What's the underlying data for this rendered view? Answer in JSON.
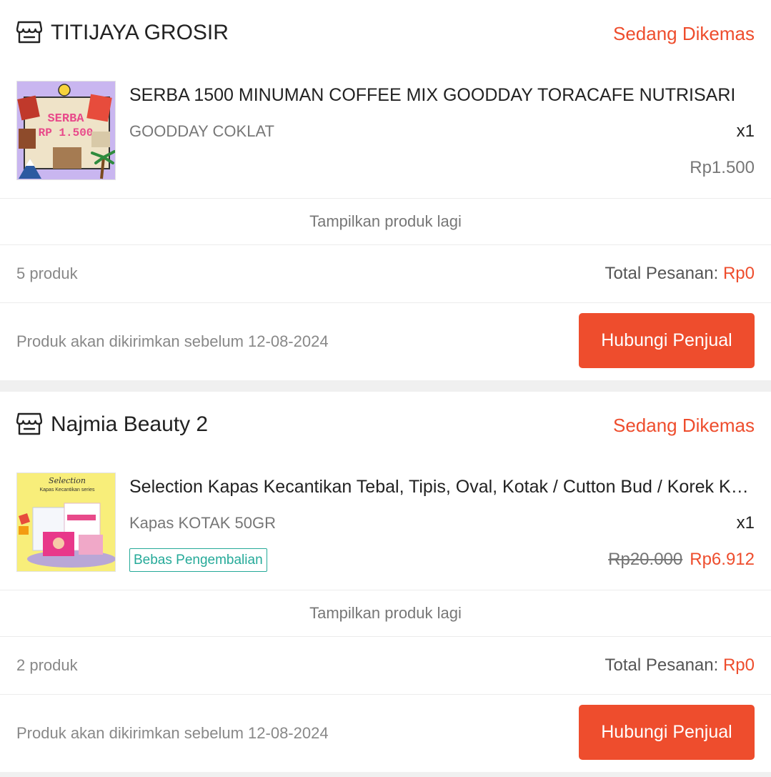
{
  "orders": [
    {
      "shop_name": "TITIJAYA GROSIR",
      "status": "Sedang Dikemas",
      "product": {
        "name": "SERBA 1500 MINUMAN COFFEE MIX GOODDAY TORACAFE NUTRISARI",
        "variant": "GOODDAY COKLAT",
        "quantity": "x1",
        "price": "Rp1.500",
        "thumb_text_1": "SERBA",
        "thumb_text_2": "RP 1.500"
      },
      "show_more": "Tampilkan produk lagi",
      "product_count": "5 produk",
      "total_label": "Total Pesanan:",
      "total_amount": "Rp0",
      "shipping_note": "Produk akan dikirimkan sebelum 12-08-2024",
      "contact_button": "Hubungi Penjual"
    },
    {
      "shop_name": "Najmia Beauty 2",
      "status": "Sedang Dikemas",
      "product": {
        "name": "Selection Kapas Kecantikan Tebal, Tipis, Oval, Kotak / Cutton Bud / Korek Kuping",
        "variant": "Kapas KOTAK 50GR",
        "quantity": "x1",
        "original_price": "Rp20.000",
        "price": "Rp6.912",
        "tag": "Bebas Pengembalian",
        "thumb_text_1": "Selection",
        "thumb_text_2": "Kapas Kecantikan series"
      },
      "show_more": "Tampilkan produk lagi",
      "product_count": "2 produk",
      "total_label": "Total Pesanan:",
      "total_amount": "Rp0",
      "shipping_note": "Produk akan dikirimkan sebelum 12-08-2024",
      "contact_button": "Hubungi Penjual"
    }
  ],
  "colors": {
    "accent": "#ee4d2d",
    "tag": "#26aa99",
    "background": "#f0f0f0"
  },
  "icons": {
    "shop": "store-icon"
  }
}
